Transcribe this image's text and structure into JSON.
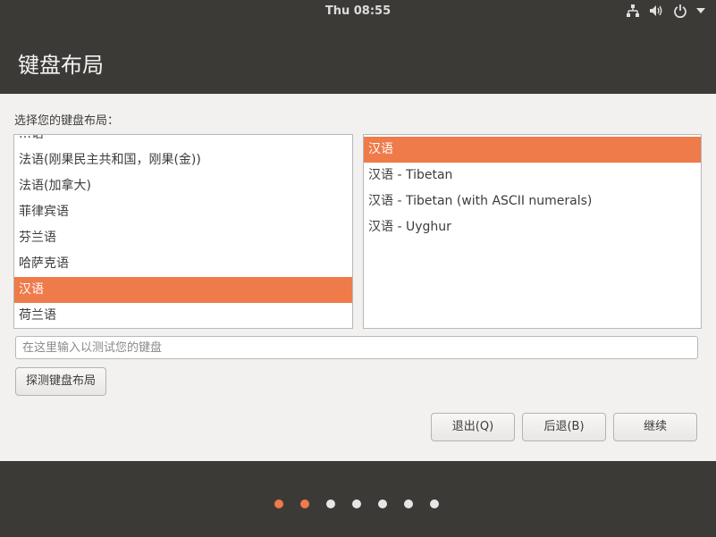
{
  "topbar": {
    "clock": "Thu 08:55",
    "icons": [
      "network-icon",
      "volume-icon",
      "power-icon",
      "menu-arrow-icon"
    ]
  },
  "header": {
    "title": "键盘布局"
  },
  "prompt": "选择您的键盘布局：",
  "layout_list": {
    "items": [
      "…语",
      "法语(刚果民主共和国，刚果(金))",
      "法语(加拿大)",
      "菲律宾语",
      "芬兰语",
      "哈萨克语",
      "汉语",
      "荷兰语"
    ],
    "selected": "汉语"
  },
  "variant_list": {
    "items": [
      "汉语",
      "汉语 - Tibetan",
      "汉语 - Tibetan (with ASCII numerals)",
      "汉语 - Uyghur"
    ],
    "selected": "汉语"
  },
  "test_input": {
    "placeholder": "在这里输入以测试您的键盘",
    "value": ""
  },
  "buttons": {
    "detect": "探测键盘布局",
    "quit": "退出(Q)",
    "back": "后退(B)",
    "continue": "继续"
  },
  "progress": {
    "total_steps": 7,
    "current_step": 2
  },
  "colors": {
    "accent": "#ef7a4a",
    "chrome": "#3b3a37",
    "background": "#f2f1f0"
  }
}
